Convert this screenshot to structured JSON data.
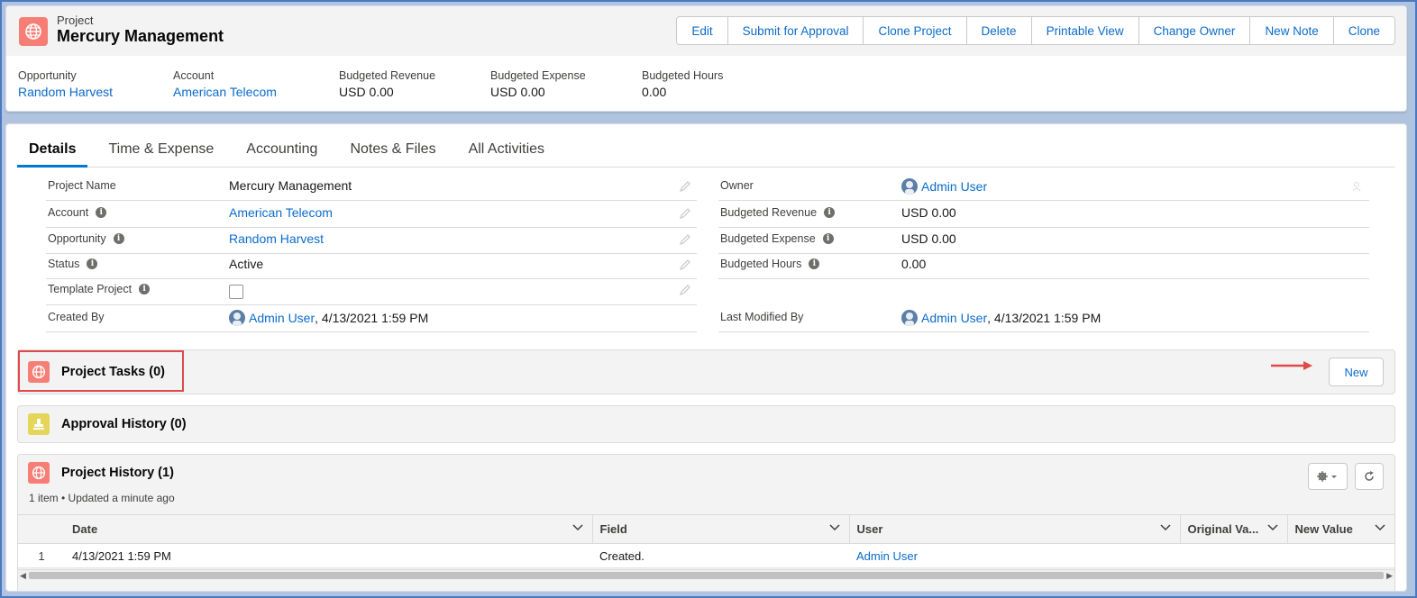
{
  "header": {
    "record_type": "Project",
    "title": "Mercury Management",
    "actions": [
      "Edit",
      "Submit for Approval",
      "Clone Project",
      "Delete",
      "Printable View",
      "Change Owner",
      "New Note",
      "Clone"
    ],
    "highlights": [
      {
        "label": "Opportunity",
        "value": "Random Harvest",
        "is_link": true
      },
      {
        "label": "Account",
        "value": "American Telecom",
        "is_link": true
      },
      {
        "label": "Budgeted Revenue",
        "value": "USD 0.00",
        "is_link": false
      },
      {
        "label": "Budgeted Expense",
        "value": "USD 0.00",
        "is_link": false
      },
      {
        "label": "Budgeted Hours",
        "value": "0.00",
        "is_link": false
      }
    ]
  },
  "tabs": [
    "Details",
    "Time & Expense",
    "Accounting",
    "Notes & Files",
    "All Activities"
  ],
  "details": {
    "left": [
      {
        "label": "Project Name",
        "value": "Mercury Management"
      },
      {
        "label": "Account",
        "value": "American Telecom"
      },
      {
        "label": "Opportunity",
        "value": "Random Harvest"
      },
      {
        "label": "Status",
        "value": "Active"
      },
      {
        "label": "Template Project",
        "value": ""
      },
      {
        "label": "Created By",
        "value": "Admin User",
        "suffix": ", 4/13/2021 1:59 PM"
      }
    ],
    "right": [
      {
        "label": "Owner",
        "value": "Admin User"
      },
      {
        "label": "Budgeted Revenue",
        "value": "USD 0.00"
      },
      {
        "label": "Budgeted Expense",
        "value": "USD 0.00"
      },
      {
        "label": "Budgeted Hours",
        "value": "0.00"
      },
      {
        "label": "Last Modified By",
        "value": "Admin User",
        "suffix": ", 4/13/2021 1:59 PM"
      }
    ]
  },
  "related": {
    "project_tasks": {
      "title": "Project Tasks (0)",
      "new_label": "New"
    },
    "approval_history": {
      "title": "Approval History (0)"
    },
    "project_history": {
      "title": "Project History (1)",
      "meta": "1 item • Updated a minute ago",
      "columns": [
        "Date",
        "Field",
        "User",
        "Original Va...",
        "New Value"
      ],
      "rows": [
        {
          "num": "1",
          "date": "4/13/2021 1:59 PM",
          "field": "Created.",
          "user": "Admin User",
          "original": "",
          "new": ""
        }
      ]
    }
  },
  "colors": {
    "project_icon": "#f77e75",
    "approval_icon": "#e3d65a",
    "link": "#0b6bcb",
    "annotation": "#e04a4a"
  },
  "icons": {
    "project": "globe-icon",
    "approval": "stamp-icon"
  }
}
